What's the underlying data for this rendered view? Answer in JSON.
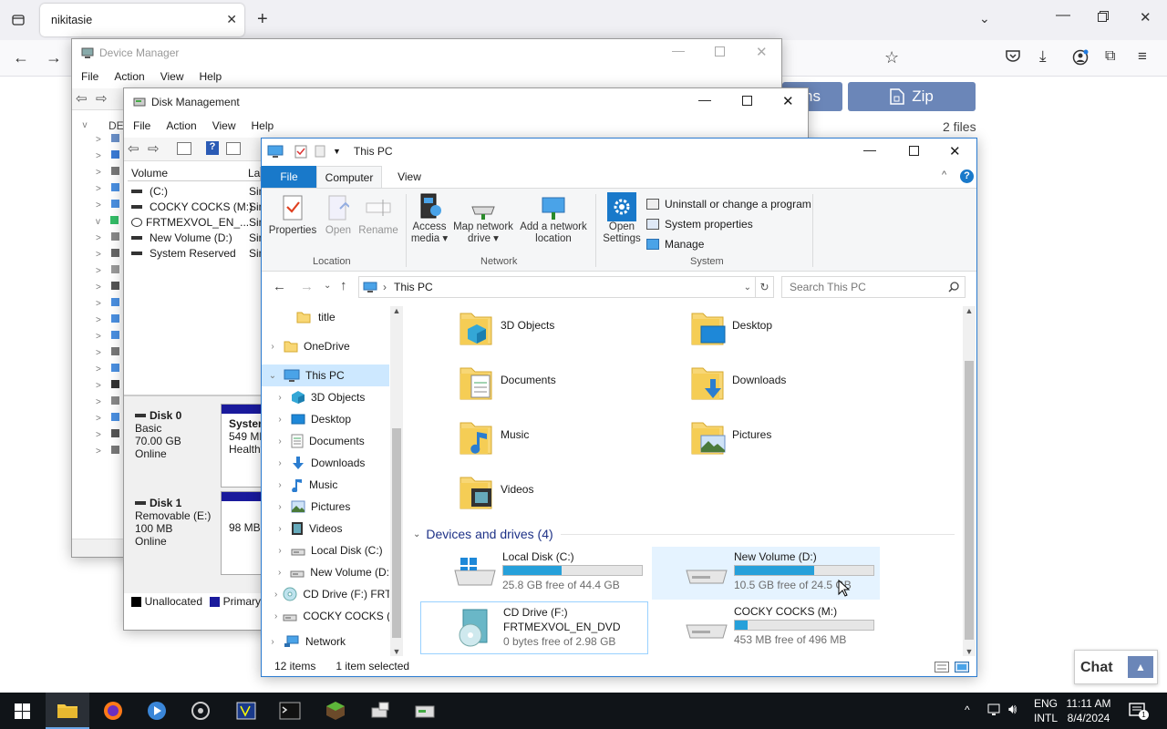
{
  "firefox": {
    "tab_title": "nikitasie",
    "web_buttons": {
      "left_partial": "ns",
      "zip": "Zip"
    },
    "file_count": "2 files",
    "chat_label": "Chat"
  },
  "device_manager": {
    "title": "Device Manager",
    "menu": [
      "File",
      "Action",
      "View",
      "Help"
    ],
    "root_label": "DE"
  },
  "disk_management": {
    "title": "Disk Management",
    "menu": [
      "File",
      "Action",
      "View",
      "Help"
    ],
    "columns": [
      "Volume",
      "La"
    ],
    "volumes": [
      {
        "name": "(C:)",
        "layout": "Sin"
      },
      {
        "name": "COCKY COCKS (M:)",
        "layout": "Sin"
      },
      {
        "name": "FRTMEXVOL_EN_...",
        "layout": "Sin"
      },
      {
        "name": "New Volume (D:)",
        "layout": "Sin"
      },
      {
        "name": "System Reserved",
        "layout": "Sin"
      }
    ],
    "disks": [
      {
        "name": "Disk 0",
        "type": "Basic",
        "size": "70.00 GB",
        "status": "Online",
        "part_name": "System",
        "part_size": "549 MB",
        "part_status": "Healthy"
      },
      {
        "name": "Disk 1",
        "type": "Removable (E:)",
        "size": "100 MB",
        "status": "Online",
        "part_size": "98 MB"
      }
    ],
    "legend": [
      {
        "label": "Unallocated",
        "color": "#000000"
      },
      {
        "label": "Primary",
        "color": "#1a1a9c"
      }
    ]
  },
  "explorer": {
    "title": "This PC",
    "tabs": [
      "File",
      "Computer",
      "View"
    ],
    "ribbon": {
      "location": {
        "label": "Location",
        "items": [
          "Properties",
          "Open",
          "Rename"
        ]
      },
      "network": {
        "label": "Network",
        "items": [
          [
            "Access",
            "media ▾"
          ],
          [
            "Map network",
            "drive ▾"
          ],
          [
            "Add a network",
            "location"
          ]
        ]
      },
      "system": {
        "label": "System",
        "open_settings": [
          "Open",
          "Settings"
        ],
        "links": [
          "Uninstall or change a program",
          "System properties",
          "Manage"
        ]
      }
    },
    "address": "This PC",
    "search_placeholder": "Search This PC",
    "nav": [
      {
        "label": "title",
        "level": 1,
        "expand": "",
        "icon": "folder-icon"
      },
      {
        "label": "OneDrive",
        "level": 0,
        "expand": ">",
        "icon": "folder-icon"
      },
      {
        "label": "This PC",
        "level": 0,
        "expand": "v",
        "icon": "pc-icon",
        "selected": true
      },
      {
        "label": "3D Objects",
        "level": 1,
        "expand": ">",
        "icon": "cube-icon"
      },
      {
        "label": "Desktop",
        "level": 1,
        "expand": ">",
        "icon": "desktop-icon"
      },
      {
        "label": "Documents",
        "level": 1,
        "expand": ">",
        "icon": "document-icon"
      },
      {
        "label": "Downloads",
        "level": 1,
        "expand": ">",
        "icon": "download-icon"
      },
      {
        "label": "Music",
        "level": 1,
        "expand": ">",
        "icon": "music-icon"
      },
      {
        "label": "Pictures",
        "level": 1,
        "expand": ">",
        "icon": "picture-icon"
      },
      {
        "label": "Videos",
        "level": 1,
        "expand": ">",
        "icon": "video-icon"
      },
      {
        "label": "Local Disk (C:)",
        "level": 1,
        "expand": ">",
        "icon": "drive-icon"
      },
      {
        "label": "New Volume (D:",
        "level": 1,
        "expand": ">",
        "icon": "drive-icon"
      },
      {
        "label": "CD Drive (F:) FRT",
        "level": 1,
        "expand": ">",
        "icon": "cd-icon"
      },
      {
        "label": "COCKY COCKS (",
        "level": 1,
        "expand": ">",
        "icon": "drive-icon"
      },
      {
        "label": "Network",
        "level": 0,
        "expand": ">",
        "icon": "network-icon"
      }
    ],
    "folders": [
      "3D Objects",
      "Desktop",
      "Documents",
      "Downloads",
      "Music",
      "Pictures",
      "Videos"
    ],
    "devices_header": "Devices and drives (4)",
    "drives": [
      {
        "name": "Local Disk (C:)",
        "sub": "",
        "free": "25.8 GB free of 44.4 GB",
        "used_fraction": 0.42,
        "icon": "windows-drive-icon"
      },
      {
        "name": "New Volume (D:)",
        "sub": "",
        "free": "10.5 GB free of 24.5 GB",
        "used_fraction": 0.57,
        "icon": "drive-icon",
        "hover": true
      },
      {
        "name": "CD Drive (F:)",
        "sub": "FRTMEXVOL_EN_DVD",
        "free": "0 bytes free of 2.98 GB",
        "used_fraction": null,
        "icon": "cd-icon",
        "selected": true
      },
      {
        "name": "COCKY COCKS (M:)",
        "sub": "",
        "free": "453 MB free of 496 MB",
        "used_fraction": 0.09,
        "icon": "drive-icon"
      }
    ],
    "status_items": "12 items",
    "status_selected": "1 item selected"
  },
  "taskbar": {
    "lang_top": "ENG",
    "lang_bottom": "INTL",
    "time": "11:11 AM",
    "date": "8/4/2024",
    "notification_count": "1"
  }
}
